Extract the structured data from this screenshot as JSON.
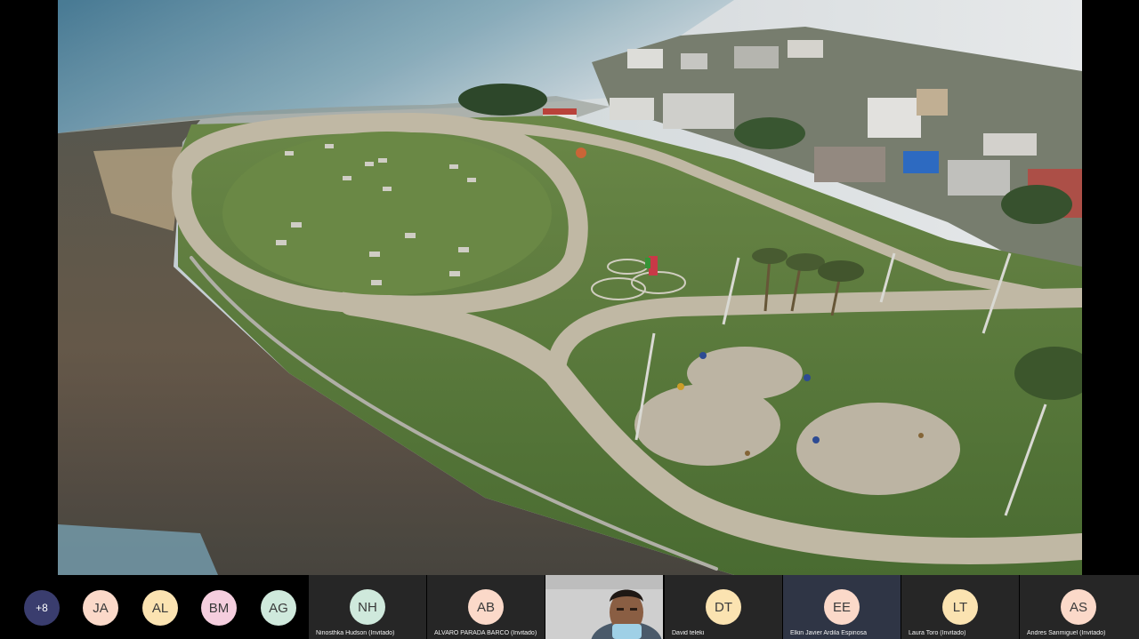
{
  "colors": {
    "overflow_badge": "#3a3d6e",
    "avatar_peach": "#fbd9c9",
    "avatar_cream": "#fbe3b1",
    "avatar_pink": "#f5cede",
    "avatar_mint": "#cfe9dc",
    "tile_bg": "#262626",
    "tile_bg_alt": "#2f3545"
  },
  "overflow": {
    "label": "+8"
  },
  "mini_avatars": [
    {
      "initials": "JA"
    },
    {
      "initials": "AL"
    },
    {
      "initials": "BM"
    },
    {
      "initials": "AG"
    }
  ],
  "tiles": [
    {
      "initials": "NH",
      "name": "Ninosthka Hudson (Invitado)"
    },
    {
      "initials": "AB",
      "name": "ALVARO PARADA BARCO (Invitado)"
    },
    {
      "initials": "",
      "name": ""
    },
    {
      "initials": "DT",
      "name": "David teleki"
    },
    {
      "initials": "EE",
      "name": "Elkin Javier Ardila Espinosa"
    },
    {
      "initials": "LT",
      "name": "Laura Toro (Invitado)"
    },
    {
      "initials": "AS",
      "name": "Andres Sanmiguel (Invitado)"
    }
  ]
}
